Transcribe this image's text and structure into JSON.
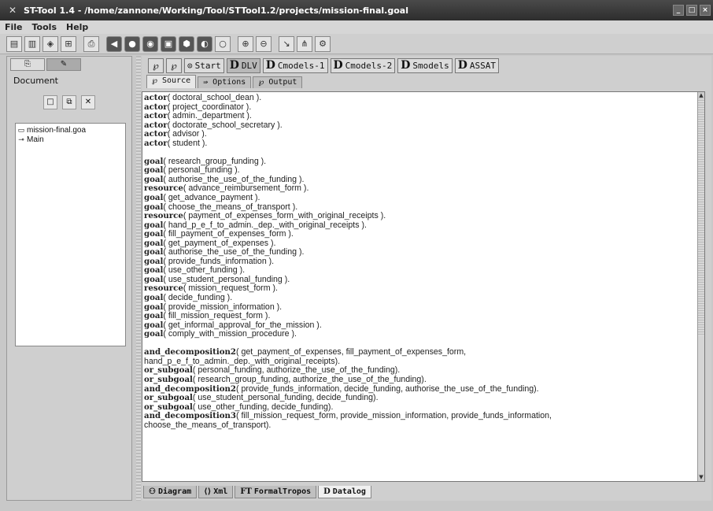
{
  "window": {
    "title": "ST-Tool 1.4 - /home/zannone/Working/Tool/STTool1.2/projects/mission-final.goal",
    "controls": [
      "_",
      "□",
      "×"
    ]
  },
  "menubar": {
    "items": [
      "File",
      "Tools",
      "Help"
    ]
  },
  "left_panel": {
    "document_label": "Document",
    "tree": [
      {
        "label": "mission-final.goa",
        "icon": "folder-icon"
      },
      {
        "label": "Main",
        "icon": "diagram-icon"
      }
    ]
  },
  "viewbar": {
    "start_label": "Start",
    "buttons": [
      "DLV",
      "Cmodels-1",
      "Cmodels-2",
      "Smodels",
      "ASSAT"
    ]
  },
  "editor_tabs": [
    "Source",
    "Options",
    "Output"
  ],
  "bottom_tabs": [
    "Diagram",
    "Xml",
    "FormalTropos",
    "Datalog"
  ],
  "source_lines": [
    [
      "actor",
      "( doctoral_school_dean )."
    ],
    [
      "actor",
      "( project_coordinator )."
    ],
    [
      "actor",
      "( admin._department )."
    ],
    [
      "actor",
      "( doctorate_school_secretary )."
    ],
    [
      "actor",
      "( advisor )."
    ],
    [
      "actor",
      "( student )."
    ],
    [
      "",
      ""
    ],
    [
      "goal",
      "( research_group_funding )."
    ],
    [
      "goal",
      "( personal_funding )."
    ],
    [
      "goal",
      "( authorise_the_use_of_the_funding )."
    ],
    [
      "resource",
      "( advance_reimbursement_form )."
    ],
    [
      "goal",
      "( get_advance_payment )."
    ],
    [
      "goal",
      "( choose_the_means_of_transport )."
    ],
    [
      "resource",
      "( payment_of_expenses_form_with_original_receipts )."
    ],
    [
      "goal",
      "( hand_p_e_f_to_admin._dep._with_original_receipts )."
    ],
    [
      "goal",
      "( fill_payment_of_expenses_form )."
    ],
    [
      "goal",
      "( get_payment_of_expenses )."
    ],
    [
      "goal",
      "( authorise_the_use_of_the_funding )."
    ],
    [
      "goal",
      "( provide_funds_information )."
    ],
    [
      "goal",
      "( use_other_funding )."
    ],
    [
      "goal",
      "( use_student_personal_funding )."
    ],
    [
      "resource",
      "( mission_request_form )."
    ],
    [
      "goal",
      "( decide_funding )."
    ],
    [
      "goal",
      "( provide_mission_information )."
    ],
    [
      "goal",
      "( fill_mission_request_form )."
    ],
    [
      "goal",
      "( get_informal_approval_for_the_mission )."
    ],
    [
      "goal",
      "( comply_with_mission_procedure )."
    ],
    [
      "",
      ""
    ],
    [
      "and_decomposition2",
      "( get_payment_of_expenses, fill_payment_of_expenses_form,"
    ],
    [
      "",
      "hand_p_e_f_to_admin._dep._with_original_receipts)."
    ],
    [
      "or_subgoal",
      "( personal_funding, authorize_the_use_of_the_funding)."
    ],
    [
      "or_subgoal",
      "( research_group_funding, authorize_the_use_of_the_funding)."
    ],
    [
      "and_decomposition2",
      "( provide_funds_information, decide_funding, authorise_the_use_of_the_funding)."
    ],
    [
      "or_subgoal",
      "( use_student_personal_funding, decide_funding)."
    ],
    [
      "or_subgoal",
      "( use_other_funding, decide_funding)."
    ],
    [
      "and_decomposition3",
      "( fill_mission_request_form, provide_mission_information, provide_funds_information,"
    ],
    [
      "",
      "choose_the_means_of_transport)."
    ]
  ]
}
